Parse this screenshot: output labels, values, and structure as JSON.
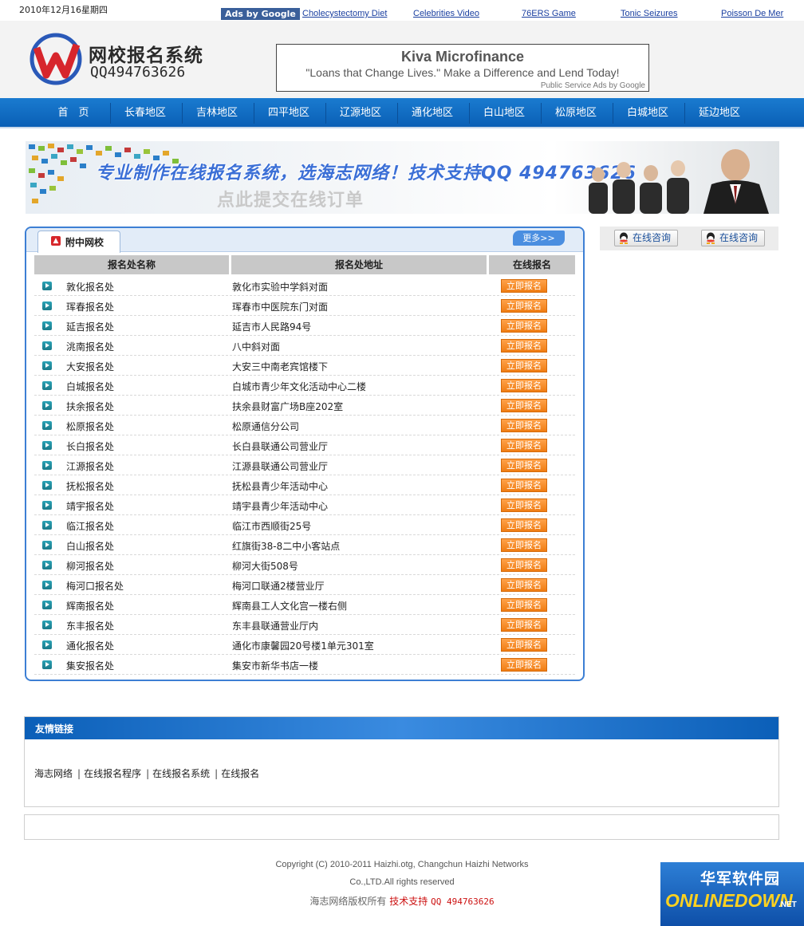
{
  "topbar": {
    "date": "2010年12月16星期四",
    "ads_label": "Ads by Google",
    "ad_links": [
      "Cholecystectomy Diet",
      "Celebrities Video",
      "76ERS Game",
      "Tonic Seizures",
      "Poisson De Mer"
    ]
  },
  "header": {
    "logo_title": "网校报名系统",
    "logo_qq": "QQ494763626",
    "ad": {
      "title": "Kiva Microfinance",
      "text": "\"Loans that Change Lives.\" Make a Difference and Lend Today!",
      "footer": "Public Service Ads by Google"
    }
  },
  "nav": [
    "首　页",
    "长春地区",
    "吉林地区",
    "四平地区",
    "辽源地区",
    "通化地区",
    "白山地区",
    "松原地区",
    "白城地区",
    "延边地区"
  ],
  "banner": {
    "headline": "专业制作在线报名系统，选海志网络！技术支持QQ 494763626",
    "subline": "点此提交在线订单"
  },
  "main": {
    "tab_label": "附中网校",
    "more_label": "更多>>",
    "columns": [
      "报名处名称",
      "报名处地址",
      "在线报名"
    ],
    "signup_label": "立即报名",
    "rows": [
      {
        "name": "敦化报名处",
        "addr": "敦化市实验中学斜对面"
      },
      {
        "name": "珲春报名处",
        "addr": "珲春市中医院东门对面"
      },
      {
        "name": "延吉报名处",
        "addr": "延吉市人民路94号"
      },
      {
        "name": "洮南报名处",
        "addr": "八中斜对面"
      },
      {
        "name": "大安报名处",
        "addr": "大安三中南老宾馆楼下"
      },
      {
        "name": "白城报名处",
        "addr": "白城市青少年文化活动中心二楼"
      },
      {
        "name": "扶余报名处",
        "addr": "扶余县财富广场B座202室"
      },
      {
        "name": "松原报名处",
        "addr": "松原通信分公司"
      },
      {
        "name": "长白报名处",
        "addr": "长白县联通公司营业厅"
      },
      {
        "name": "江源报名处",
        "addr": "江源县联通公司营业厅"
      },
      {
        "name": "抚松报名处",
        "addr": "抚松县青少年活动中心"
      },
      {
        "name": "靖宇报名处",
        "addr": "靖宇县青少年活动中心"
      },
      {
        "name": "临江报名处",
        "addr": "临江市西顺街25号"
      },
      {
        "name": "白山报名处",
        "addr": "红旗街38-8二中小客站点"
      },
      {
        "name": "柳河报名处",
        "addr": "柳河大街508号"
      },
      {
        "name": "梅河口报名处",
        "addr": "梅河口联通2楼营业厅"
      },
      {
        "name": "辉南报名处",
        "addr": "辉南县工人文化宫一楼右侧"
      },
      {
        "name": "东丰报名处",
        "addr": "东丰县联通营业厅内"
      },
      {
        "name": "通化报名处",
        "addr": "通化市康馨园20号楼1单元301室"
      },
      {
        "name": "集安报名处",
        "addr": "集安市新华书店一楼"
      }
    ]
  },
  "sidebar": {
    "qq_buttons": [
      "在线咨询",
      "在线咨询"
    ]
  },
  "links": {
    "title": "友情链接",
    "items": [
      "海志网络",
      "在线报名程序",
      "在线报名系统",
      "在线报名"
    ],
    "separator": "|"
  },
  "footer": {
    "copyright": "Copyright (C) 2010-2011 Haizhi.otg, Changchun Haizhi Networks",
    "rights": "Co.,LTD.All rights reserved",
    "owner": "海志网络版权所有",
    "tech": "技术支持",
    "qq": "QQ 494763626"
  },
  "watermark": {
    "cn": "华军软件园",
    "en": "ONLINEDOWN",
    "net": ".NET"
  },
  "colors": {
    "nav_blue": "#0a5fb5",
    "box_border": "#3d7fd4",
    "button_orange": "#f07c12",
    "footer_red": "#cc1111"
  }
}
